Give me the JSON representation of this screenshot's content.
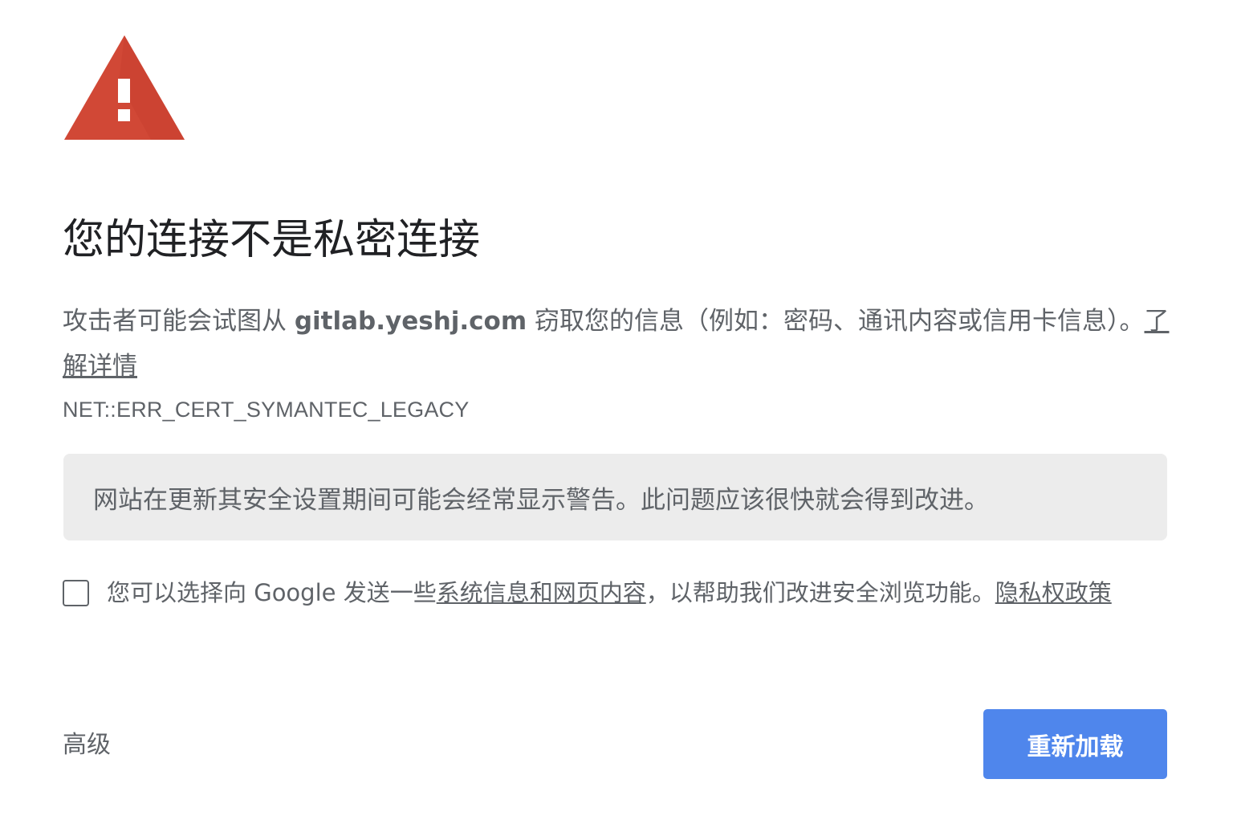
{
  "icon": {
    "name": "warning-triangle-icon",
    "color": "#d14836"
  },
  "heading": "您的连接不是私密连接",
  "explanation": {
    "prefix": "攻击者可能会试图从 ",
    "host": "gitlab.yeshj.com",
    "suffix": " 窃取您的信息（例如：密码、通讯内容或信用卡信息）。",
    "learn_more": "了解详情"
  },
  "error_code": "NET::ERR_CERT_SYMANTEC_LEGACY",
  "notice": "网站在更新其安全设置期间可能会经常显示警告。此问题应该很快就会得到改进。",
  "optin": {
    "checked": false,
    "prefix": "您可以选择向 Google 发送一些",
    "link1": "系统信息和网页内容",
    "middle": "，以帮助我们改进安全浏览功能。",
    "link2": "隐私权政策"
  },
  "footer": {
    "advanced_label": "高级",
    "reload_label": "重新加载",
    "reload_color": "#4f86ec"
  }
}
